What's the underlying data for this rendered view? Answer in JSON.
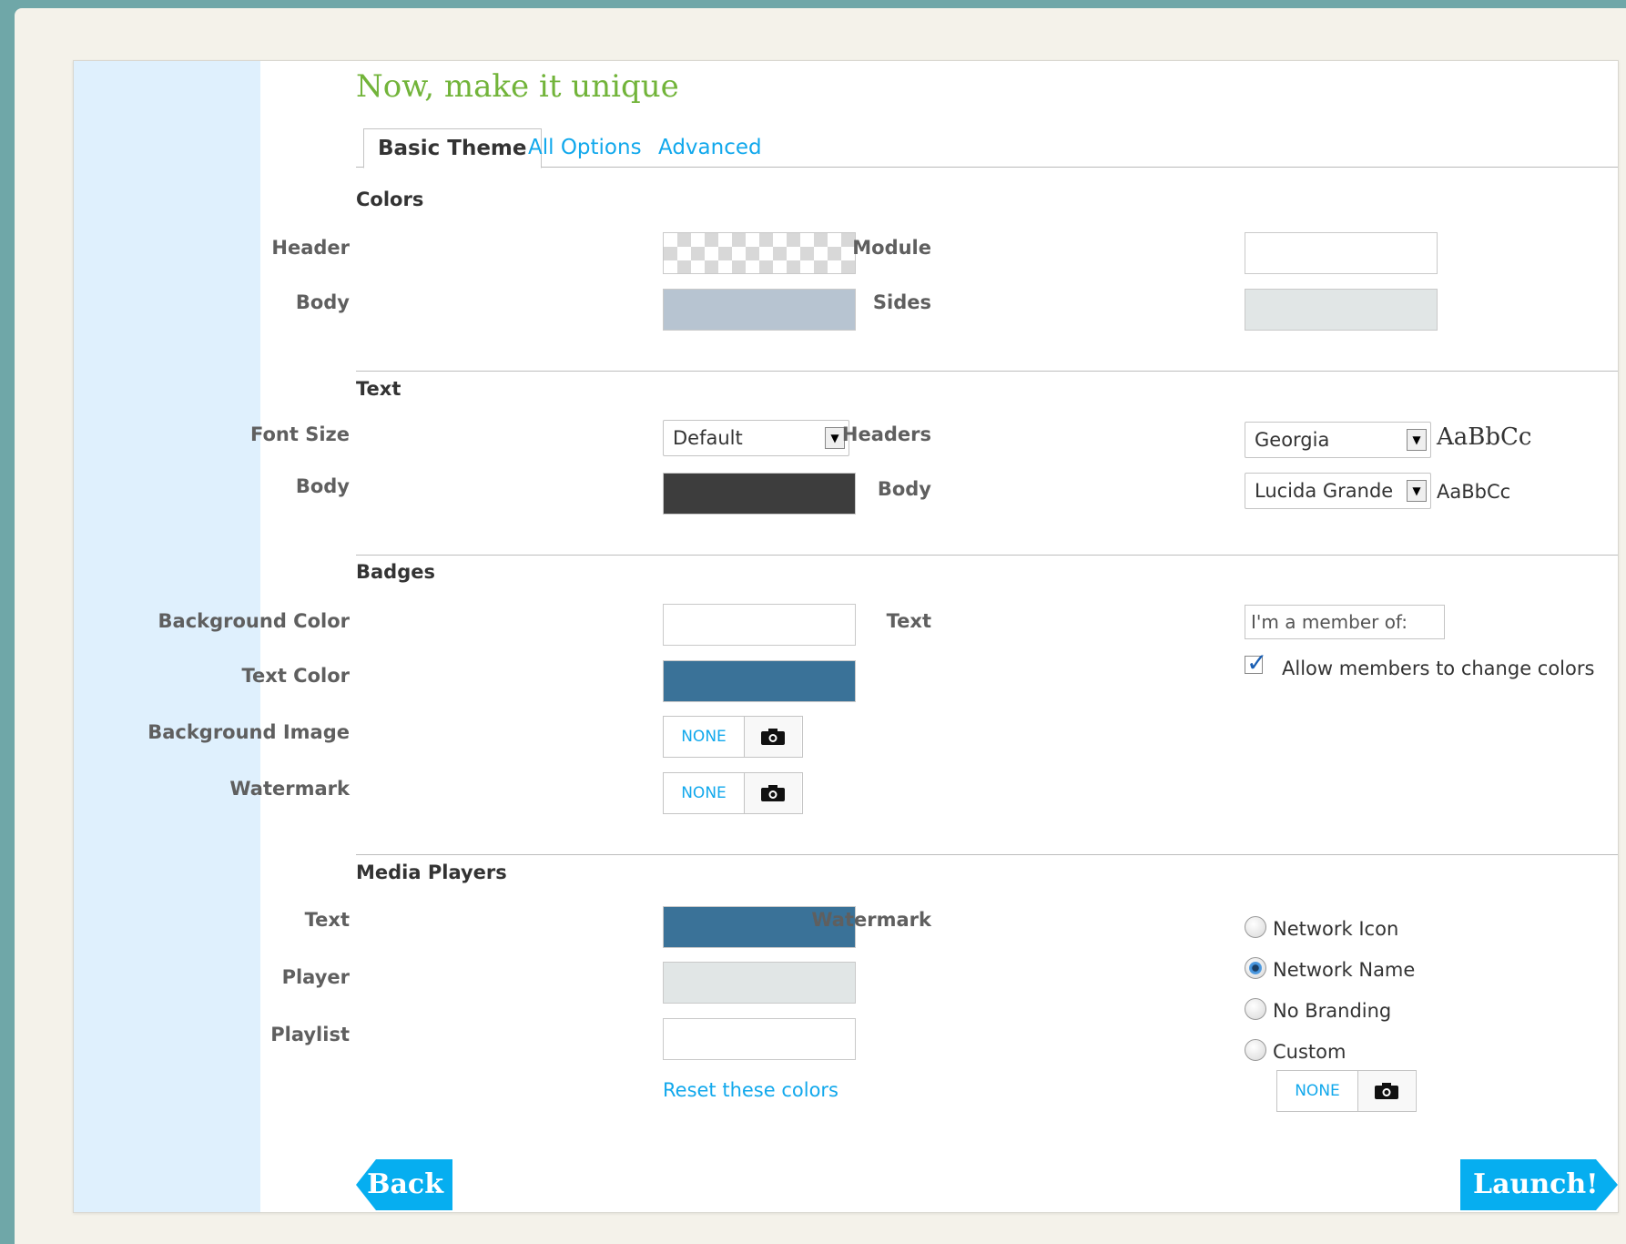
{
  "title": "Now, make it unique",
  "tabs": [
    {
      "label": "Basic Theme",
      "active": true
    },
    {
      "label": "All Options",
      "active": false
    },
    {
      "label": "Advanced",
      "active": false
    }
  ],
  "colors": {
    "section": "Colors",
    "header_label": "Header",
    "body_label": "Body",
    "module_label": "Module",
    "sides_label": "Sides",
    "body_color": "#b7c4d1",
    "module_color": "#ffffff",
    "sides_color": "#e1e6e6"
  },
  "text": {
    "section": "Text",
    "font_size_label": "Font Size",
    "font_size_value": "Default",
    "body_label": "Body",
    "body_color": "#3d3d3d",
    "headers_label": "Headers",
    "headers_font": "Georgia",
    "headers_sample": "AaBbCc",
    "body_font_label": "Body",
    "body_font": "Lucida Grande",
    "body_sample": "AaBbCc"
  },
  "badges": {
    "section": "Badges",
    "bg_color_label": "Background Color",
    "text_color_label": "Text Color",
    "bg_image_label": "Background Image",
    "watermark_label": "Watermark",
    "none_label": "NONE",
    "bg_color": "#ffffff",
    "text_color": "#3a7298",
    "text_label": "Text",
    "text_value": "I'm a member of:",
    "allow_label": "Allow members to change colors",
    "allow_checked": true
  },
  "media": {
    "section": "Media Players",
    "text_label": "Text",
    "player_label": "Player",
    "playlist_label": "Playlist",
    "text_color": "#3a7298",
    "player_color": "#e1e6e6",
    "playlist_color": "#ffffff",
    "reset_link": "Reset these colors",
    "watermark_label": "Watermark",
    "options": [
      "Network Icon",
      "Network Name",
      "No Branding",
      "Custom"
    ],
    "selected": "Network Name",
    "none_label": "NONE"
  },
  "nav": {
    "back": "Back",
    "launch": "Launch!"
  }
}
